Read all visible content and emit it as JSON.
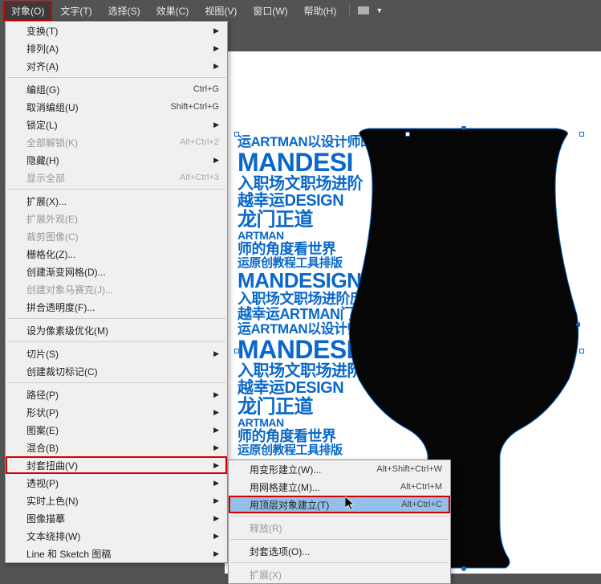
{
  "menubar": {
    "items": [
      "对象(O)",
      "文字(T)",
      "选择(S)",
      "效果(C)",
      "视图(V)",
      "窗口(W)",
      "帮助(H)"
    ]
  },
  "menu": {
    "groups": [
      [
        {
          "label": "变换(T)",
          "arrow": true
        },
        {
          "label": "排列(A)",
          "arrow": true
        },
        {
          "label": "对齐(A)",
          "arrow": true
        }
      ],
      [
        {
          "label": "编组(G)",
          "shortcut": "Ctrl+G"
        },
        {
          "label": "取消编组(U)",
          "shortcut": "Shift+Ctrl+G"
        },
        {
          "label": "锁定(L)",
          "arrow": true
        },
        {
          "label": "全部解锁(K)",
          "shortcut": "Alt+Ctrl+2",
          "disabled": true
        },
        {
          "label": "隐藏(H)",
          "arrow": true
        },
        {
          "label": "显示全部",
          "shortcut": "Alt+Ctrl+3",
          "disabled": true
        }
      ],
      [
        {
          "label": "扩展(X)..."
        },
        {
          "label": "扩展外观(E)",
          "disabled": true
        },
        {
          "label": "裁剪图像(C)",
          "disabled": true
        },
        {
          "label": "栅格化(Z)..."
        },
        {
          "label": "创建渐变网格(D)..."
        },
        {
          "label": "创建对象马赛克(J)...",
          "disabled": true
        },
        {
          "label": "拼合透明度(F)..."
        }
      ],
      [
        {
          "label": "设为像素级优化(M)"
        }
      ],
      [
        {
          "label": "切片(S)",
          "arrow": true
        },
        {
          "label": "创建裁切标记(C)"
        }
      ],
      [
        {
          "label": "路径(P)",
          "arrow": true
        },
        {
          "label": "形状(P)",
          "arrow": true
        },
        {
          "label": "图案(E)",
          "arrow": true
        },
        {
          "label": "混合(B)",
          "arrow": true
        },
        {
          "label": "封套扭曲(V)",
          "arrow": true,
          "highlighted": true
        },
        {
          "label": "透视(P)",
          "arrow": true
        },
        {
          "label": "实时上色(N)",
          "arrow": true
        },
        {
          "label": "图像描摹",
          "arrow": true
        },
        {
          "label": "文本绕排(W)",
          "arrow": true
        },
        {
          "label": "Line 和 Sketch 图稿",
          "arrow": true
        }
      ]
    ]
  },
  "submenu": {
    "items": [
      {
        "label": "用变形建立(W)...",
        "shortcut": "Alt+Shift+Ctrl+W"
      },
      {
        "label": "用网格建立(M)...",
        "shortcut": "Alt+Ctrl+M"
      },
      {
        "label": "用顶层对象建立(T)",
        "shortcut": "Alt+Ctrl+C",
        "highlighted": true,
        "hover": true
      },
      {
        "label": "释放(R)",
        "disabled": true,
        "sep_before": true
      },
      {
        "label": "封套选项(O)...",
        "sep_before": true
      },
      {
        "label": "扩展(X)",
        "disabled": true,
        "sep_before": true
      }
    ]
  },
  "collage": {
    "lines": [
      {
        "text": "运ARTMAN以设计师的",
        "size": 17
      },
      {
        "text": "MANDESI",
        "size": 32
      },
      {
        "text": "入职场文职场进阶",
        "size": 20
      },
      {
        "text": "越幸运DESIGN",
        "size": 20
      },
      {
        "text": "龙门正道",
        "size": 24
      },
      {
        "text": "ARTMAN",
        "size": 14
      },
      {
        "text": "师的角度看世界",
        "size": 18
      },
      {
        "text": "运原创教程工具排版",
        "size": 15
      },
      {
        "text": "MANDESIGN",
        "size": 26
      },
      {
        "text": "入职场文职场进阶庞",
        "size": 18
      },
      {
        "text": "越幸运ARTMAN门",
        "size": 18
      }
    ]
  }
}
